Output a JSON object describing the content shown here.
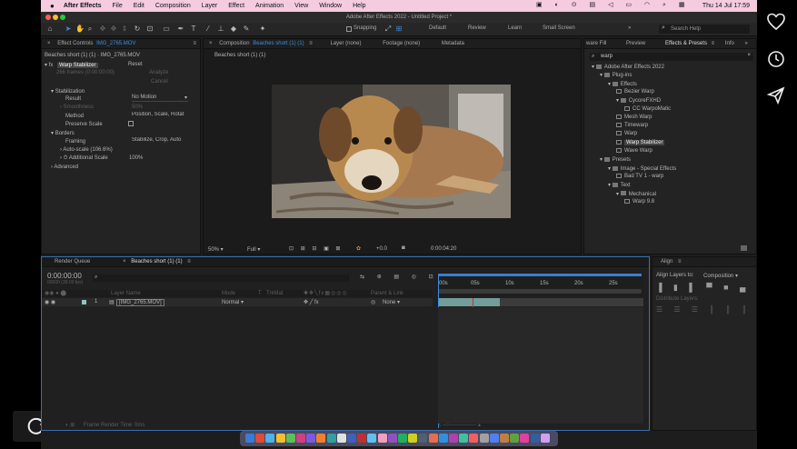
{
  "menubar": {
    "app_name": "After Effects",
    "items": [
      "File",
      "Edit",
      "Composition",
      "Layer",
      "Effect",
      "Animation",
      "View",
      "Window",
      "Help"
    ],
    "clock": "Thu 14 Jul  17:59"
  },
  "window_title": "Adobe After Effects 2022 - Untitled Project *",
  "toolbar": {
    "snapping_label": "Snapping",
    "workspaces": [
      "Default",
      "Review",
      "Learn",
      "Small Screen"
    ],
    "search_placeholder": "Search Help"
  },
  "effect_controls": {
    "tab_label": "Effect Controls",
    "file_label": "IMG_2765.MOV",
    "source_line": "Beaches short (1) (1) · IMG_2765.MOV",
    "effect_name": "Warp Stabilizer",
    "reset_label": "Reset",
    "frames_note": "266 frames (0:00:00:00)",
    "analyze_label": "Analyze",
    "cancel_label": "Cancel",
    "stabilization_label": "Stabilization",
    "result_label": "Result",
    "result_value": "No Motion",
    "smoothness_label": "Smoothness",
    "smoothness_value": "50%",
    "method_label": "Method",
    "method_value": "Position, Scale, Rotat",
    "preserve_scale_label": "Preserve Scale",
    "borders_label": "Borders",
    "framing_label": "Framing",
    "framing_value": "Stabilize, Crop, Auto",
    "autoscale_label": "Auto-scale (106.6%)",
    "additional_scale_label": "Additional Scale",
    "additional_scale_value": "100%",
    "advanced_label": "Advanced"
  },
  "composition": {
    "tab_label": "Composition",
    "comp_name": "Beaches short (1) (1)",
    "other_tabs": [
      "Layer (none)",
      "Footage (none)",
      "Metadata"
    ],
    "sub_tab": "Beaches short (1) (1)",
    "zoom": "50%",
    "quality": "Full",
    "exposure": "+0.0",
    "timecode": "0:00:04:20"
  },
  "effects_presets": {
    "tabs": [
      "Effects & Presets",
      "Preview",
      "Info"
    ],
    "left_tab": "ware Fill",
    "search_value": "warp",
    "tree": [
      {
        "label": "Adobe After Effects 2022",
        "depth": 0,
        "kind": "folder"
      },
      {
        "label": "Plug-ins",
        "depth": 1,
        "kind": "folder"
      },
      {
        "label": "Effects",
        "depth": 2,
        "kind": "folder"
      },
      {
        "label": "Bezier Warp",
        "depth": 3,
        "kind": "fx"
      },
      {
        "label": "CycoreFXHD",
        "depth": 3,
        "kind": "folder"
      },
      {
        "label": "CC WarpoMatic",
        "depth": 4,
        "kind": "fx"
      },
      {
        "label": "Mesh Warp",
        "depth": 3,
        "kind": "fx"
      },
      {
        "label": "Timewarp",
        "depth": 3,
        "kind": "fx"
      },
      {
        "label": "Warp",
        "depth": 3,
        "kind": "fx"
      },
      {
        "label": "Warp Stabilizer",
        "depth": 3,
        "kind": "fx",
        "selected": true
      },
      {
        "label": "Wave Warp",
        "depth": 3,
        "kind": "fx"
      },
      {
        "label": "Presets",
        "depth": 1,
        "kind": "folder"
      },
      {
        "label": "Image - Special Effects",
        "depth": 2,
        "kind": "folder"
      },
      {
        "label": "Bad TV 1 - warp",
        "depth": 3,
        "kind": "fx"
      },
      {
        "label": "Text",
        "depth": 2,
        "kind": "folder"
      },
      {
        "label": "Mechanical",
        "depth": 3,
        "kind": "folder"
      },
      {
        "label": "Warp 9.8",
        "depth": 4,
        "kind": "fx"
      }
    ]
  },
  "timeline": {
    "tabs": [
      "Render Queue",
      "Beaches short (1) (1)"
    ],
    "timecode": "0:00:00:00",
    "fps_note": "00000 (30.00 fps)",
    "columns": [
      "Layer Name",
      "Mode",
      "T",
      "TrkMat",
      "Parent & Link"
    ],
    "layer_index": "1",
    "layer_name": "[IMG_2765.MOV]",
    "layer_mode": "Normal",
    "parent_value": "None",
    "ruler_labels": [
      "00s",
      "05s",
      "10s",
      "15s",
      "20s",
      "25s"
    ],
    "footer_label": "Frame Render Time",
    "footer_value": "0ms"
  },
  "align": {
    "title": "Align",
    "align_to_label": "Align Layers to:",
    "align_to_value": "Composition",
    "distribute_label": "Distribute Layers:"
  },
  "side_controls": {
    "icons": [
      "heart-icon",
      "clock-icon",
      "send-icon",
      "refresh-icon"
    ]
  }
}
